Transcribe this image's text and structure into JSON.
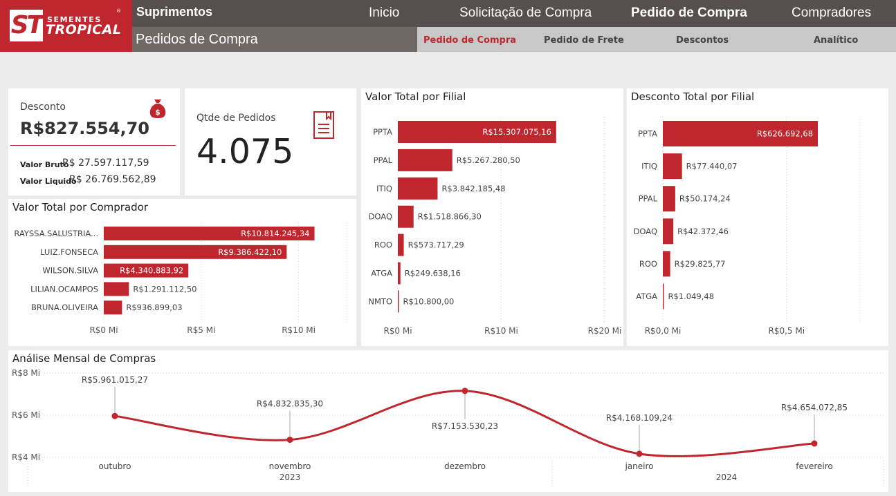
{
  "brand": {
    "top": "SEMENTES",
    "main": "TROPICAL",
    "mark": "ST",
    "reg": "®",
    "color": "#c0262d"
  },
  "header": {
    "app_title": "Suprimentos",
    "page_title": "Pedidos de Compra",
    "nav": [
      "Inicio",
      "Solicitação de Compra",
      "Pedido de Compra",
      "Compradores"
    ],
    "active_nav": "Pedido de Compra",
    "subnav": [
      "Pedido de Compra",
      "Pedido de Frete",
      "Descontos",
      "Analítico"
    ],
    "active_subnav": "Pedido de Compra"
  },
  "kpi_desconto": {
    "label": "Desconto",
    "value": "R$827.554,70",
    "icon": "money-bag-icon",
    "bruto_label": "Valor Bruto",
    "bruto_value": "R$ 27.597.117,59",
    "liquido_label": "Valor Liquido",
    "liquido_value": "R$ 26.769.562,89"
  },
  "kpi_pedidos": {
    "label": "Qtde de Pedidos",
    "value": "4.075",
    "icon": "document-icon"
  },
  "chart_data": [
    {
      "id": "comprador",
      "type": "bar",
      "orientation": "horizontal",
      "title": "Valor Total por Comprador",
      "categories": [
        "RAYSSA.SALUSTRIA...",
        "LUIZ.FONSECA",
        "WILSON.SILVA",
        "LILIAN.OCAMPOS",
        "BRUNA.OLIVEIRA"
      ],
      "values": [
        10814245.34,
        9386422.1,
        4340883.92,
        1291112.5,
        936899.03
      ],
      "labels": [
        "R$10.814.245,34",
        "R$9.386.422,10",
        "R$4.340.883,92",
        "R$1.291.112,50",
        "R$936.899,03"
      ],
      "xlim": [
        0,
        12500000
      ],
      "ticks": [
        0,
        5000000,
        10000000
      ],
      "tick_labels": [
        "R$0 Mi",
        "R$5 Mi",
        "R$10 Mi"
      ],
      "grid": true,
      "color": "#c0262d"
    },
    {
      "id": "filial",
      "type": "bar",
      "orientation": "horizontal",
      "title": "Valor Total por Filial",
      "categories": [
        "PPTA",
        "PPAL",
        "ITIQ",
        "DOAQ",
        "ROO",
        "ATGA",
        "NMTO"
      ],
      "values": [
        15307075.16,
        5267280.5,
        3842185.48,
        1518866.3,
        573717.29,
        249638.16,
        10800.0
      ],
      "labels": [
        "R$15.307.075,16",
        "R$5.267.280,50",
        "R$3.842.185,48",
        "R$1.518.866,30",
        "R$573.717,29",
        "R$249.638,16",
        "R$10.800,00"
      ],
      "xlim": [
        0,
        20000000
      ],
      "ticks": [
        0,
        10000000,
        20000000
      ],
      "tick_labels": [
        "R$0 Mi",
        "R$10 Mi",
        "R$20 Mi"
      ],
      "grid": true,
      "color": "#c0262d"
    },
    {
      "id": "desconto_filial",
      "type": "bar",
      "orientation": "horizontal",
      "title": "Desconto Total por Filial",
      "categories": [
        "PPTA",
        "ITIQ",
        "PPAL",
        "DOAQ",
        "ROO",
        "ATGA"
      ],
      "values": [
        626692.68,
        77440.07,
        50174.24,
        42372.46,
        29825.77,
        1049.48
      ],
      "labels": [
        "R$626.692,68",
        "R$77.440,07",
        "R$50.174,24",
        "R$42.372,46",
        "R$29.825,77",
        "R$1.049,48"
      ],
      "xlim": [
        0,
        800000
      ],
      "ticks": [
        0,
        500000
      ],
      "tick_labels": [
        "R$0,0 Mi",
        "R$0,5 Mi"
      ],
      "grid": true,
      "color": "#c0262d"
    },
    {
      "id": "mensal",
      "type": "line",
      "title": "Análise Mensal de Compras",
      "x": [
        "outubro",
        "novembro",
        "dezembro",
        "janeiro",
        "fevereiro"
      ],
      "years": [
        {
          "label": "2023",
          "months": [
            "outubro",
            "novembro",
            "dezembro"
          ]
        },
        {
          "label": "2024",
          "months": [
            "janeiro",
            "fevereiro"
          ]
        }
      ],
      "values": [
        5961015.27,
        4832835.3,
        7153530.23,
        4168109.24,
        4654072.85
      ],
      "labels": [
        "R$5.961.015,27",
        "R$4.832.835,30",
        "R$7.153.530,23",
        "R$4.168.109,24",
        "R$4.654.072,85"
      ],
      "ylim": [
        4000000,
        8000000
      ],
      "yticks": [
        4000000,
        6000000,
        8000000
      ],
      "ytick_labels": [
        "R$4 Mi",
        "R$6 Mi",
        "R$8 Mi"
      ],
      "grid": true,
      "color": "#c0262d"
    }
  ]
}
